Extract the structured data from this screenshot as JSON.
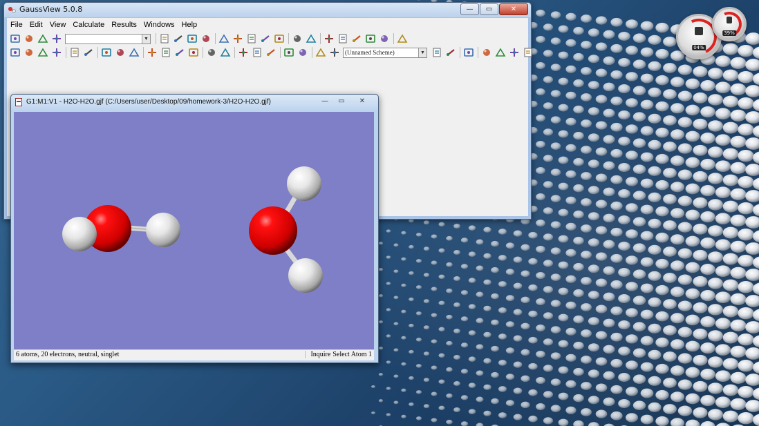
{
  "main_window": {
    "title": "GaussView 5.0.8",
    "caption": {
      "minimize": "—",
      "maximize": "▭",
      "close": "✕"
    },
    "menu": [
      "File",
      "Edit",
      "View",
      "Calculate",
      "Results",
      "Windows",
      "Help"
    ]
  },
  "toolbar": {
    "scheme_combo": "(Unnamed Scheme)",
    "icons_row1": [
      "builder-icon",
      "ring-icon",
      "r-group-icon",
      "chain-icon",
      "custom-fragment-icon",
      "bond-icon",
      "angle-icon",
      "dihedral-icon",
      "inquire-icon",
      "add-valence-icon",
      "delete-atom-icon",
      "rebond-icon",
      "symmetrize-icon",
      "clean-icon",
      "new-icon",
      "open-icon",
      "save-icon",
      "print-icon",
      "image-icon",
      "window-icon",
      "list-icon"
    ],
    "icons_row2": [
      "cut-icon",
      "copy-icon",
      "paste-icon",
      "delete-icon",
      "undo-icon",
      "redo-icon",
      "select-icon",
      "brush-icon",
      "select-more-icon",
      "atom-labels-icon",
      "r-labels-icon",
      "bond-labels-icon",
      "layers-icon",
      "diamond-icon",
      "pin-icon",
      "add-fragment-icon",
      "fit-icon",
      "center-icon",
      "copy-view-icon",
      "paste-view-icon",
      "gaussian-calc-icon",
      "results-icon",
      "color-scheme-icon",
      "view-icon",
      "options-icon",
      "cascade-icon",
      "tile-icon",
      "back-icon",
      "forward-icon"
    ]
  },
  "molecule_window": {
    "title": "G1:M1:V1 - H2O-H2O.gjf (C:/Users/user/Desktop/09/homework-3/H2O-H2O.gjf)",
    "caption": {
      "minimize": "—",
      "maximize": "▭",
      "close": "✕"
    },
    "status_left": "6 atoms, 20 electrons, neutral, singlet",
    "status_mode": "Inquire",
    "status_action": "Select Atom 1"
  },
  "gadget": {
    "cpu": "04%",
    "memory": "39%"
  },
  "colors": {
    "viewport_bg": "#7e7fc6",
    "oxygen": "#e00000",
    "hydrogen": "#e8e8e8"
  }
}
